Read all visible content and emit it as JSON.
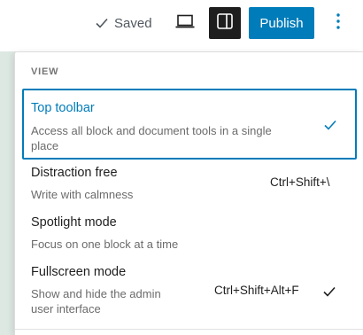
{
  "header": {
    "saved_label": "Saved",
    "saved_icon": "check-icon",
    "preview_icon": "laptop-icon",
    "settings_icon": "sidebar-toggle-icon",
    "publish_label": "Publish",
    "options_icon": "vertical-ellipsis-icon",
    "accent_color": "#007cba"
  },
  "menu": {
    "heading": "VIEW",
    "items": [
      {
        "title": "Top toolbar",
        "desc_line1": "Access all block and document tools in a single",
        "desc_line2": "place",
        "shortcut": "",
        "checked": true,
        "selected": true
      },
      {
        "title": "Distraction free",
        "desc_line1": "Write with calmness",
        "desc_line2": "",
        "shortcut": "Ctrl+Shift+\\",
        "checked": false,
        "selected": false
      },
      {
        "title": "Spotlight mode",
        "desc_line1": "Focus on one block at a time",
        "desc_line2": "",
        "shortcut": "",
        "checked": false,
        "selected": false
      },
      {
        "title": "Fullscreen mode",
        "desc_line1": "Show and hide the admin",
        "desc_line2": "user interface",
        "shortcut": "Ctrl+Shift+Alt+F",
        "checked": true,
        "selected": false
      }
    ]
  }
}
